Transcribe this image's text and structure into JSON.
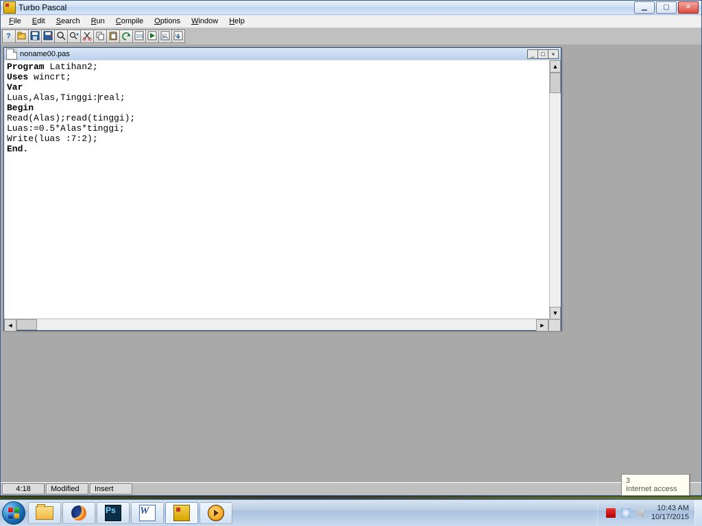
{
  "app": {
    "title": "Turbo Pascal"
  },
  "menus": [
    {
      "label": "File",
      "u": "F"
    },
    {
      "label": "Edit",
      "u": "E"
    },
    {
      "label": "Search",
      "u": "S"
    },
    {
      "label": "Run",
      "u": "R"
    },
    {
      "label": "Compile",
      "u": "C"
    },
    {
      "label": "Options",
      "u": "O"
    },
    {
      "label": "Window",
      "u": "W"
    },
    {
      "label": "Help",
      "u": "H"
    }
  ],
  "toolbar_buttons": [
    "help",
    "open",
    "save",
    "save-as",
    "find",
    "find-again",
    "cut",
    "copy",
    "paste",
    "undo",
    "compile",
    "run",
    "step-over",
    "trace-into"
  ],
  "document": {
    "filename": "noname00.pas",
    "lines": [
      {
        "parts": [
          {
            "t": "Program",
            "b": true
          },
          {
            "t": " Latihan2;"
          }
        ]
      },
      {
        "parts": [
          {
            "t": "Uses",
            "b": true
          },
          {
            "t": " wincrt;"
          }
        ]
      },
      {
        "parts": [
          {
            "t": "Var",
            "b": true
          }
        ]
      },
      {
        "parts": [
          {
            "t": "Luas,Alas,Tinggi:"
          },
          {
            "cursor": true
          },
          {
            "t": "real;"
          }
        ]
      },
      {
        "parts": [
          {
            "t": "Begin",
            "b": true
          }
        ]
      },
      {
        "parts": [
          {
            "t": "Read(Alas);read(tinggi);"
          }
        ]
      },
      {
        "parts": [
          {
            "t": "Luas:=0.5*Alas*tinggi;"
          }
        ]
      },
      {
        "parts": [
          {
            "t": "Write(luas :7:2);"
          }
        ]
      },
      {
        "parts": [
          {
            "t": "End.",
            "b": true
          }
        ]
      }
    ]
  },
  "status": {
    "pos": "4:18",
    "modified": "Modified",
    "insert": "Insert"
  },
  "tooltip": {
    "line1": "3",
    "line2": "Internet access"
  },
  "tray": {
    "time": "10:43 AM",
    "date": "10/17/2015"
  },
  "taskbar_items": [
    {
      "name": "file-explorer",
      "cls": "ico-folder"
    },
    {
      "name": "firefox",
      "cls": "ico-firefox"
    },
    {
      "name": "photoshop",
      "cls": "ico-ps",
      "glyph": "Ps"
    },
    {
      "name": "word",
      "cls": "ico-word",
      "glyph": "W"
    },
    {
      "name": "turbo-pascal",
      "cls": "ico-tp",
      "active": true
    },
    {
      "name": "aimp",
      "cls": "ico-aimp"
    }
  ]
}
